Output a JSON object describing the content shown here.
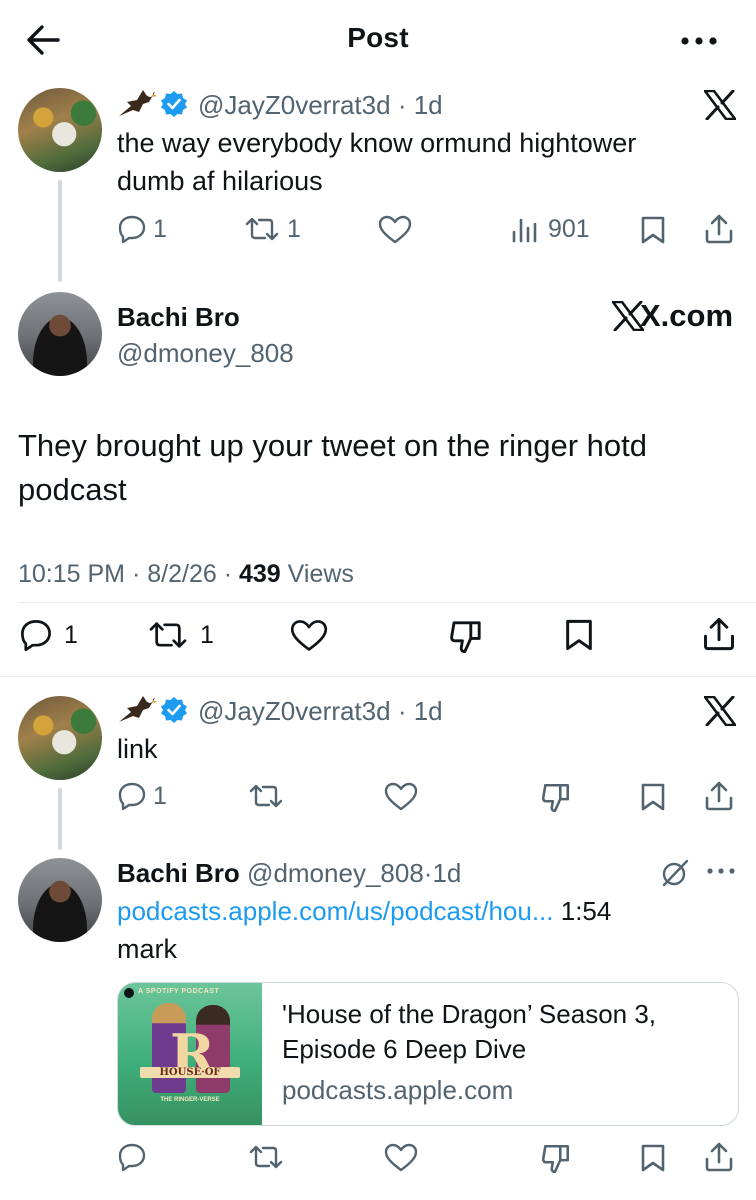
{
  "header": {
    "title": "Post"
  },
  "reply1": {
    "handle": "@JayZ0verrat3d",
    "dot": "·",
    "time": "1d",
    "text_line1": "the way everybody know ormund hightower",
    "text_line2": "dumb af hilarious",
    "replies": "1",
    "reposts": "1",
    "views": "901"
  },
  "main": {
    "name": "Bachi Bro",
    "handle": "@dmoney_808",
    "brand": "X.com",
    "text_line1": "They brought up your tweet on the ringer hotd",
    "text_line2": "podcast",
    "time": "10:15 PM",
    "dot": "·",
    "date": "8/2/26",
    "views_count": "439",
    "views_label": "Views",
    "replies": "1",
    "reposts": "1"
  },
  "reply2": {
    "handle": "@JayZ0verrat3d",
    "dot": "·",
    "time": "1d",
    "text": "link",
    "replies": "1"
  },
  "reply3": {
    "name": "Bachi Bro",
    "handle": "@dmoney_808",
    "dot": "·",
    "time": "1d",
    "link_text": "podcasts.apple.com/us/podcast/hou...",
    "timestamp": "1:54",
    "text": "mark",
    "card": {
      "image_top_label": "A SPOTIFY PODCAST",
      "image_banner": "HOUSE·OF",
      "image_sub": "THE RINGER-VERSE",
      "title_line1": "'House of the Dragon’ Season 3,",
      "title_line2": "Episode 6 Deep Dive",
      "domain": "podcasts.apple.com"
    }
  },
  "colors": {
    "accent": "#1d9bf0",
    "text": "#0f1419",
    "muted": "#536471",
    "border": "#cfd9de"
  }
}
